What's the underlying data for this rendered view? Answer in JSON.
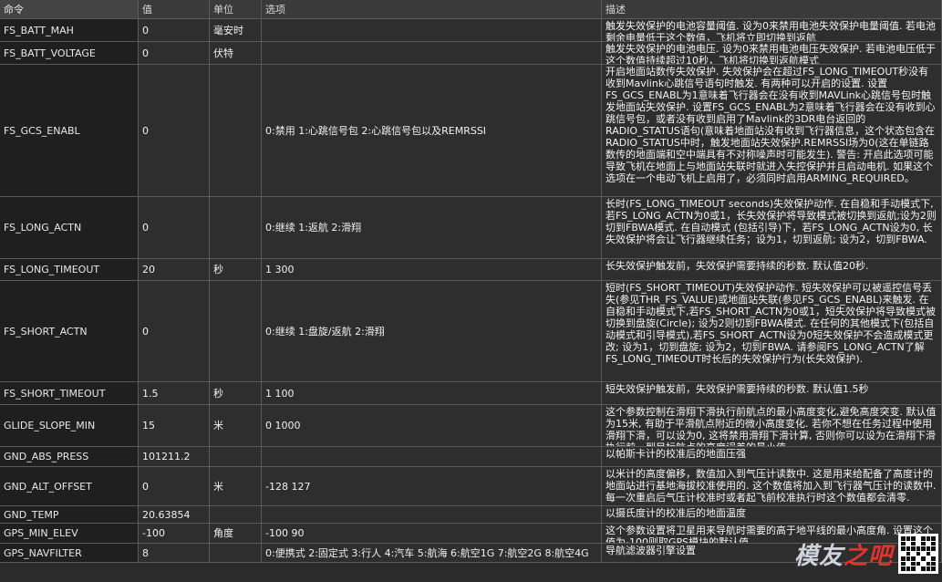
{
  "headers": [
    "命令",
    "值",
    "单位",
    "选项",
    "描述"
  ],
  "rows": [
    {
      "name": "FS_BATT_MAH",
      "value": "0",
      "unit": "毫安时",
      "options": "",
      "desc": "触发失效保护的电池容量阈值. 设为0来禁用电池失效保护电量阈值. 若电池剩余电量低于这个数值，飞机将立即切换到返航"
    },
    {
      "name": "FS_BATT_VOLTAGE",
      "value": "0",
      "unit": "伏特",
      "options": "",
      "desc": "触发失效保护的电池电压. 设为0来禁用电池电压失效保护. 若电池电压低于这个数值持续超过10秒，飞机将切换到返航模式"
    },
    {
      "name": "FS_GCS_ENABL",
      "value": "0",
      "unit": "",
      "options": "0:禁用 1:心跳信号包 2:心跳信号包以及REMRSSI",
      "desc": "开启地面站数传失效保护. 失效保护会在超过FS_LONG_TIMEOUT秒没有收到Mavlink心跳信号语句时触发. 有两种可以开启的设置. 设置FS_GCS_ENABL为1意味着飞行器会在没有收到MAVLink心跳信号包时触发地面站失效保护. 设置FS_GCS_ENABL为2意味着飞行器会在没有收到心跳信号包，或者没有收到启用了Mavlink的3DR电台返回的RADIO_STATUS语句(意味着地面站没有收到飞行器信息，这个状态包含在RADIO_STATUS中时，触发地面站失效保护.REMRSSI场为0(这在单链路数传的地面端和空中端具有不对称噪声时可能发生). 警告: 开启此选项可能导致飞机在地面上与地面站失联时就进入失控保护并且启动电机. 如果这个选项在一个电动飞机上启用了，必须同时启用ARMING_REQUIRED。"
    },
    {
      "name": "FS_LONG_ACTN",
      "value": "0",
      "unit": "",
      "options": "0:继续 1:返航 2:滑翔",
      "desc": "长时(FS_LONG_TIMEOUT seconds)失效保护动作. 在自稳和手动模式下,若FS_LONG_ACTN为0或1，长失效保护将导致模式被切换到返航;设为2则切到FBWA模式. 在自动模式 (包括引导)下，若FS_LONG_ACTN设为0, 长失效保护将会让飞行器继续任务；设为1，切到返航; 设为2，切到FBWA."
    },
    {
      "name": "FS_LONG_TIMEOUT",
      "value": "20",
      "unit": "秒",
      "options": "1 300",
      "desc": "长失效保护触发前，失效保护需要持续的秒数. 默认值20秒."
    },
    {
      "name": "FS_SHORT_ACTN",
      "value": "0",
      "unit": "",
      "options": "0:继续 1:盘旋/返航 2:滑翔",
      "desc": "短时(FS_SHORT_TIMEOUT)失效保护动作. 短失效保护可以被遥控信号丢失(参见THR_FS_VALUE)或地面站失联(参见FS_GCS_ENABL)来触发. 在自稳和手动模式下,若FS_SHORT_ACTN为0或1，短失效保护将导致模式被切换到盘旋(Circle); 设为2则切到FBWA模式. 在任何的其他模式下(包括自动模式和引导模式),若FS_SHORT_ACTN设为0短失效保护不会造成模式更改; 设为1，切到盘旋; 设为2，切到FBWA. 请参阅FS_LONG_ACTN了解FS_LONG_TIMEOUT时长后的失效保护行为(长失效保护)."
    },
    {
      "name": "FS_SHORT_TIMEOUT",
      "value": "1.5",
      "unit": "秒",
      "options": "1 100",
      "desc": "短失效保护触发前，失效保护需要持续的秒数. 默认值1.5秒"
    },
    {
      "name": "GLIDE_SLOPE_MIN",
      "value": "15",
      "unit": "米",
      "options": "0 1000",
      "desc": "这个参数控制在滑翔下滑执行前航点的最小高度变化,避免高度突变. 默认值为15米, 有助于平滑航点附近的微小高度变化. 若你不想在任务过程中使用滑翔下滑，可以设为0, 这将禁用滑翔下滑计算, 否则你可以设为在滑翔下滑执行前，到目标航点的高度误差的最小值."
    },
    {
      "name": "GND_ABS_PRESS",
      "value": "101211.2",
      "unit": "",
      "options": "",
      "desc": "以帕斯卡计的校准后的地面压强"
    },
    {
      "name": "GND_ALT_OFFSET",
      "value": "0",
      "unit": "米",
      "options": "-128 127",
      "desc": "以米计的高度偏移，数值加入到气压计读数中. 这是用来给配备了高度计的地面站进行基地海拔校准使用的. 这个数值将加入到飞行器气压计的读数中. 每一次重启后气压计校准时或者起飞前校准执行时这个数值都会清零."
    },
    {
      "name": "GND_TEMP",
      "value": "20.63854",
      "unit": "",
      "options": "",
      "desc": "以摄氏度计的校准后的地面温度"
    },
    {
      "name": "GPS_MIN_ELEV",
      "value": "-100",
      "unit": "角度",
      "options": "-100 90",
      "desc": "这个参数设置将卫星用来导航时需要的高于地平线的最小高度角. 设置这个值为-100则取GPS模块的默认值."
    },
    {
      "name": "GPS_NAVFILTER",
      "value": "8",
      "unit": "",
      "options": "0:便携式 2:固定式 3:行人 4:汽车 5:航海 6:航空1G 7:航空2G 8:航空4G",
      "desc": "导航滤波器引擎设置"
    }
  ],
  "watermark": {
    "text_a": "模友",
    "text_b": "之吧"
  }
}
